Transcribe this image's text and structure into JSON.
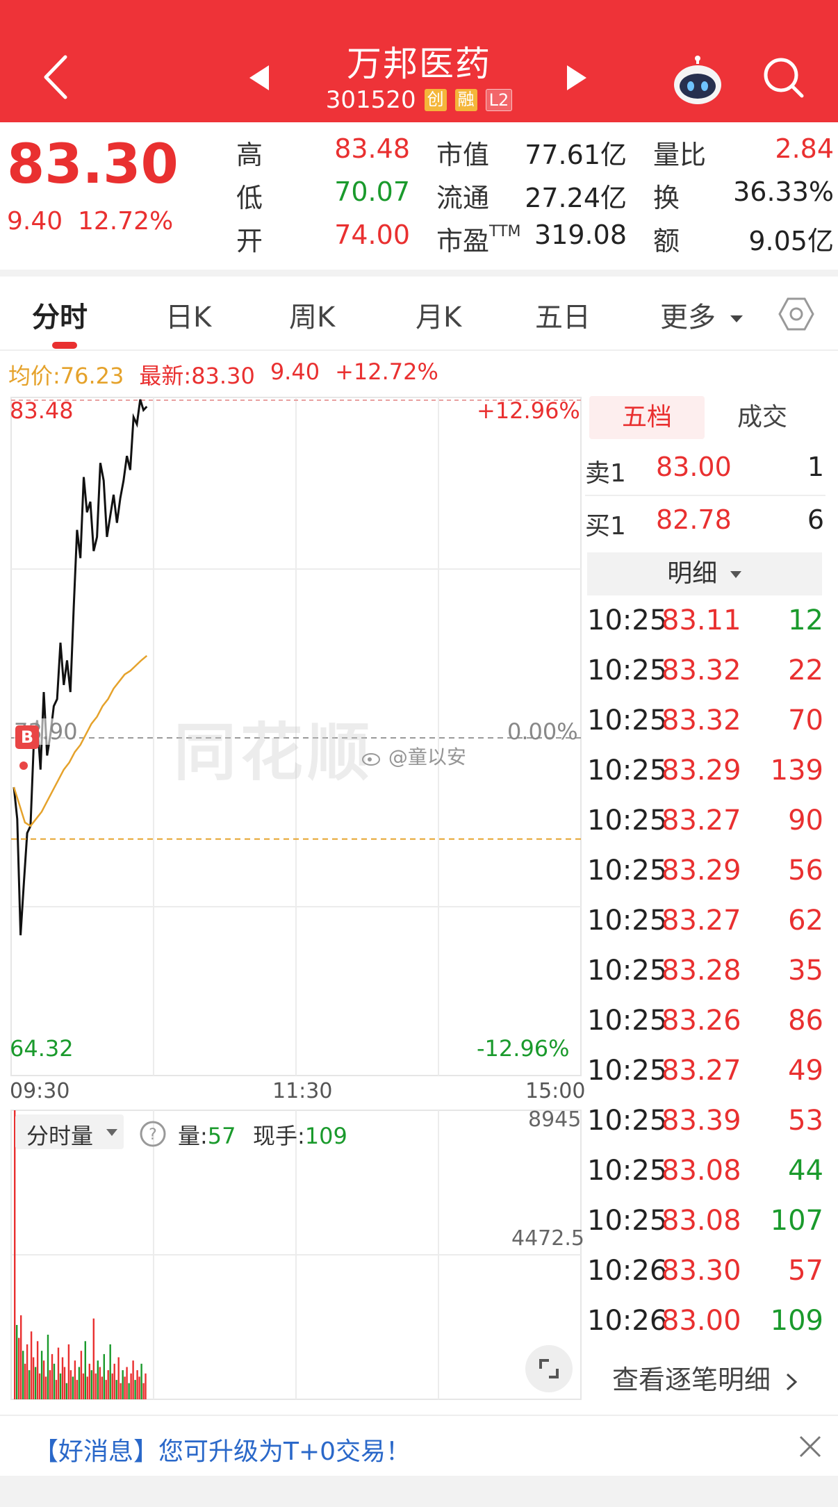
{
  "header": {
    "back_icon": "back-arrow-icon",
    "prev_icon": "left-triangle-icon",
    "next_icon": "right-triangle-icon",
    "stock_name": "万邦医药",
    "stock_code": "301520",
    "tag_chuang": "创",
    "tag_rong": "融",
    "tag_level": "L2",
    "robot_icon": "robot-assistant-icon",
    "search_icon": "search-icon"
  },
  "quote": {
    "price": "83.30",
    "change": "9.40",
    "change_pct": "12.72%",
    "high_label": "高",
    "high": "83.48",
    "low_label": "低",
    "low": "70.07",
    "open_label": "开",
    "open": "74.00",
    "mktcap_label": "市值",
    "mktcap": "77.61亿",
    "float_label": "流通",
    "float": "27.24亿",
    "pe_label": "市盈",
    "pe_sup": "TTM",
    "pe": "319.08",
    "vol_ratio_label": "量比",
    "vol_ratio": "2.84",
    "turnover_label": "换",
    "turnover": "36.33%",
    "amount_label": "额",
    "amount": "9.05亿"
  },
  "tabs": {
    "items": [
      "分时",
      "日K",
      "周K",
      "月K",
      "五日",
      "更多"
    ],
    "active": 0,
    "settings_icon": "hexagon-settings-icon"
  },
  "info_line": {
    "avg_label": "均价:76.23",
    "latest_label": "最新:83.30",
    "change": "9.40",
    "change_pct": "+12.72%"
  },
  "chart_data": [
    {
      "type": "line",
      "series": [
        {
          "values": [
            72.5,
            71.6,
            68.3,
            69.8,
            71.2,
            71.4,
            73.8,
            74.4,
            73.0,
            75.2,
            73.4,
            74.0,
            74.8,
            75.0,
            76.6,
            75.4,
            76.1,
            75.2,
            77.6,
            79.8,
            79.0,
            81.3,
            80.3,
            80.6,
            79.2,
            79.6,
            81.7,
            81.2,
            79.6,
            80.2,
            80.8,
            80.0,
            80.7,
            81.2,
            81.9,
            81.5,
            83.0,
            82.8,
            83.5,
            83.2,
            83.3
          ]
        },
        {
          "values": [
            72.5,
            72.0,
            71.5,
            71.4,
            71.6,
            71.8,
            72.1,
            72.4,
            72.7,
            73.0,
            73.2,
            73.5,
            73.7,
            74.0,
            74.3,
            74.5,
            74.8,
            75.0,
            75.3,
            75.5,
            75.7,
            75.8,
            75.95,
            76.1,
            76.23
          ]
        }
      ],
      "y_top_label": "83.48",
      "y_bottom_label": "64.32",
      "y_pct_top": "+12.96%",
      "y_pct_bottom": "-12.96%",
      "prev_close_label": "73.90",
      "prev_close_pct": "0.00%",
      "ylim": [
        64.32,
        83.48
      ],
      "prev_close": 73.9,
      "x_labels": [
        "09:30",
        "11:30",
        "15:00"
      ],
      "colors": {
        "price": "#111111",
        "avg": "#e5a22b",
        "prev_close": "#999999"
      }
    },
    {
      "type": "bar",
      "title": "分时量",
      "vol_label": "量:",
      "vol_value": "57",
      "now_label": "现手:",
      "now_value": "109",
      "y_max_label": "8945",
      "y_mid_label": "4472.5",
      "ylim": [
        0,
        8945
      ],
      "values": [
        8945,
        2300,
        1900,
        2600,
        1500,
        1100,
        1700,
        900,
        2100,
        1300,
        1000,
        1800,
        800,
        1500,
        1200,
        700,
        2000,
        900,
        1400,
        1100,
        600,
        1600,
        800,
        1300,
        1000,
        500,
        1700,
        900,
        700,
        1200,
        600,
        1000,
        1500,
        800,
        1800,
        700,
        1100,
        900,
        2500,
        800,
        1200,
        1000,
        700,
        1400,
        600,
        900,
        1700,
        800,
        1100,
        600,
        1300,
        500,
        900,
        700,
        1000,
        500,
        800,
        1200,
        600,
        900,
        700,
        1100,
        500,
        800
      ],
      "colors": {
        "up": "#e93030",
        "down": "#1a9a2c"
      }
    }
  ],
  "order_panel": {
    "tab_wudang": "五档",
    "tab_chengjiao": "成交",
    "sell_label": "卖1",
    "sell_price": "83.00",
    "sell_qty": "1",
    "buy_label": "买1",
    "buy_price": "82.78",
    "buy_qty": "6",
    "detail_label": "明细",
    "trades": [
      {
        "t": "10:25",
        "p": "83.11",
        "v": "12",
        "c": "green"
      },
      {
        "t": "10:25",
        "p": "83.32",
        "v": "22",
        "c": "red"
      },
      {
        "t": "10:25",
        "p": "83.32",
        "v": "70",
        "c": "red"
      },
      {
        "t": "10:25",
        "p": "83.29",
        "v": "139",
        "c": "red"
      },
      {
        "t": "10:25",
        "p": "83.27",
        "v": "90",
        "c": "red"
      },
      {
        "t": "10:25",
        "p": "83.29",
        "v": "56",
        "c": "red"
      },
      {
        "t": "10:25",
        "p": "83.27",
        "v": "62",
        "c": "red"
      },
      {
        "t": "10:25",
        "p": "83.28",
        "v": "35",
        "c": "red"
      },
      {
        "t": "10:25",
        "p": "83.26",
        "v": "86",
        "c": "red"
      },
      {
        "t": "10:25",
        "p": "83.27",
        "v": "49",
        "c": "red"
      },
      {
        "t": "10:25",
        "p": "83.39",
        "v": "53",
        "c": "red"
      },
      {
        "t": "10:25",
        "p": "83.08",
        "v": "44",
        "c": "green"
      },
      {
        "t": "10:25",
        "p": "83.08",
        "v": "107",
        "c": "green"
      },
      {
        "t": "10:26",
        "p": "83.30",
        "v": "57",
        "c": "red"
      },
      {
        "t": "10:26",
        "p": "83.00",
        "v": "109",
        "c": "green"
      }
    ],
    "view_all": "查看逐笔明细"
  },
  "banner": {
    "text": "【好消息】您可升级为T+0交易！",
    "close_icon": "close-icon"
  },
  "watermark": {
    "brand": "同花顺",
    "user": "@童以安"
  }
}
